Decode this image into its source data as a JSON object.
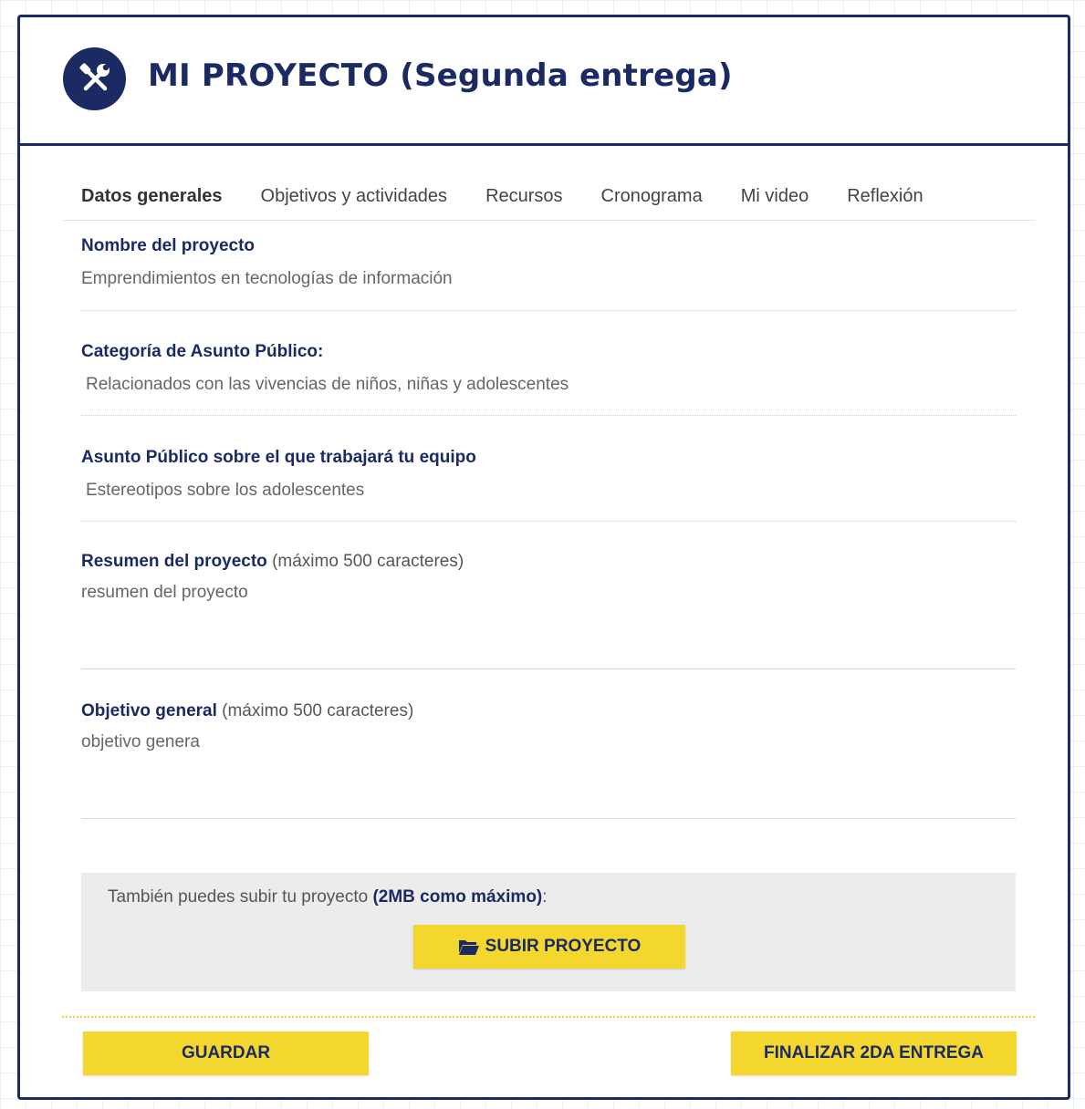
{
  "header": {
    "title": "MI PROYECTO (Segunda entrega)",
    "icon": "tools-icon"
  },
  "tabs": [
    {
      "label": "Datos generales",
      "active": true
    },
    {
      "label": "Objetivos y actividades",
      "active": false
    },
    {
      "label": "Recursos",
      "active": false
    },
    {
      "label": "Cronograma",
      "active": false
    },
    {
      "label": "Mi video",
      "active": false
    },
    {
      "label": "Reflexión",
      "active": false
    }
  ],
  "fields": {
    "project_name": {
      "label": "Nombre del proyecto",
      "value": "Emprendimientos en tecnologías de información"
    },
    "category": {
      "label": "Categoría de Asunto Público:",
      "value": "Relacionados con las vivencias de niños, niñas y adolescentes"
    },
    "public_issue": {
      "label": "Asunto Público sobre el que trabajará tu equipo",
      "value": "Estereotipos sobre los adolescentes"
    },
    "summary": {
      "label": "Resumen del proyecto",
      "hint": "(máximo 500 caracteres)",
      "value": "resumen del proyecto"
    },
    "objective": {
      "label": "Objetivo general",
      "hint": "(máximo 500 caracteres)",
      "value": "objetivo genera"
    }
  },
  "upload": {
    "text": "También puedes subir tu proyecto",
    "text_bold": "(2MB como máximo)",
    "text_suffix": ":",
    "button_label": "SUBIR PROYECTO",
    "button_icon": "folder-open-icon"
  },
  "actions": {
    "save_label": "GUARDAR",
    "finish_label": "FINALIZAR 2DA ENTREGA"
  },
  "colors": {
    "primary": "#1c2a64",
    "accent": "#f4d72e",
    "upload_bg": "#ececec"
  }
}
